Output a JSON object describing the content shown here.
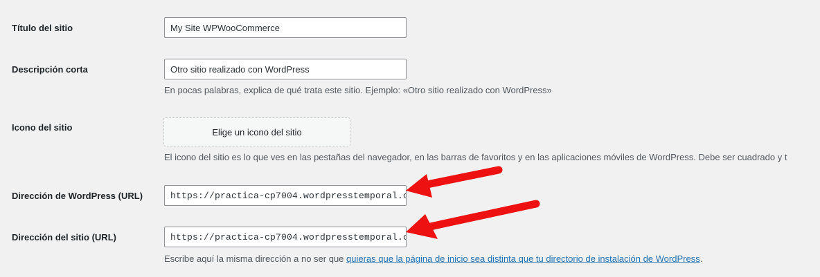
{
  "fields": {
    "site_title": {
      "label": "Título del sitio",
      "value": "My Site WPWooCommerce"
    },
    "tagline": {
      "label": "Descripción corta",
      "value": "Otro sitio realizado con WordPress",
      "description": "En pocas palabras, explica de qué trata este sitio. Ejemplo: «Otro sitio realizado con WordPress»"
    },
    "site_icon": {
      "label": "Icono del sitio",
      "button_label": "Elige un icono del sitio",
      "description": "El icono del sitio es lo que ves en las pestañas del navegador, en las barras de favoritos y en las aplicaciones móviles de WordPress. Debe ser cuadrado y t"
    },
    "wordpress_url": {
      "label": "Dirección de WordPress (URL)",
      "value": "https://practica-cp7004.wordpresstemporal.c"
    },
    "site_url": {
      "label": "Dirección del sitio (URL)",
      "value": "https://practica-cp7004.wordpresstemporal.c",
      "description_prefix": "Escribe aquí la misma dirección a no ser que ",
      "description_link": "quieras que la página de inicio sea distinta que tu directorio de instalación de WordPress",
      "description_suffix": "."
    }
  },
  "annotation_color": "#ee1111"
}
